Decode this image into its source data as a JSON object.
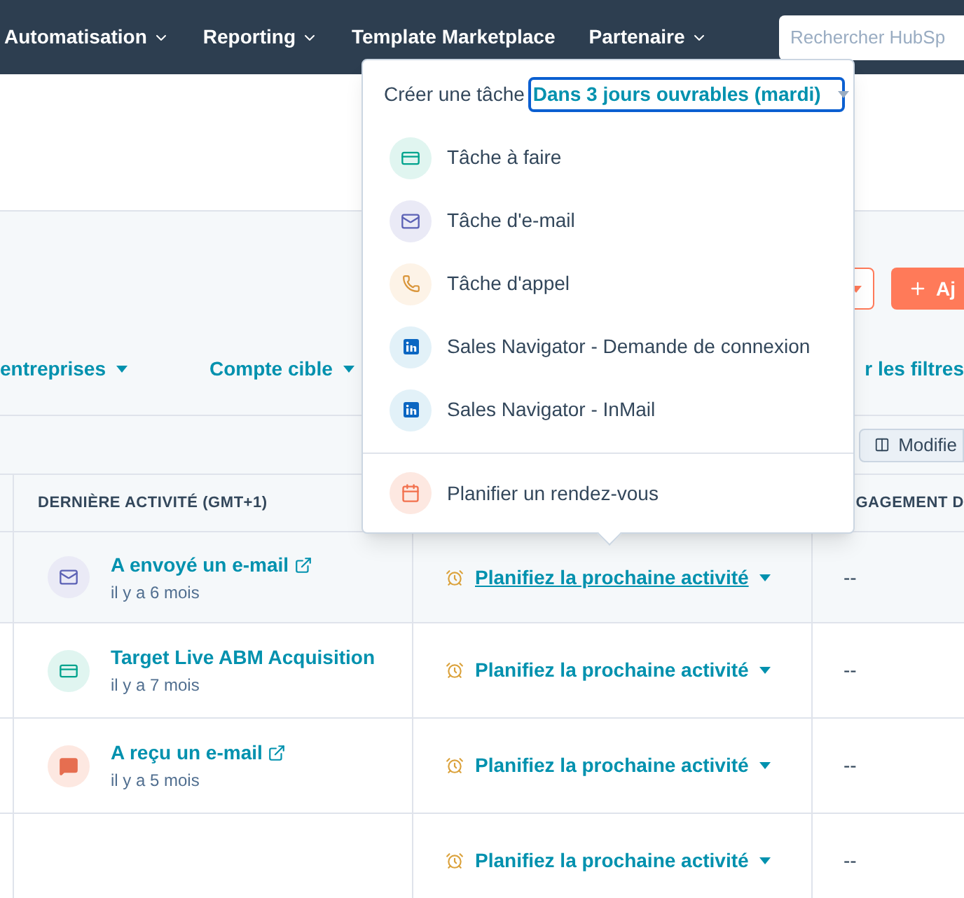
{
  "nav": {
    "items": [
      {
        "label": "Automatisation",
        "caret": true
      },
      {
        "label": "Reporting",
        "caret": true
      },
      {
        "label": "Template Marketplace",
        "caret": false
      },
      {
        "label": "Partenaire",
        "caret": true
      }
    ],
    "search": {
      "placeholder": "Rechercher HubSp"
    }
  },
  "toolbar": {
    "add_button": "Aj"
  },
  "filters": [
    {
      "label": "entreprises",
      "caret": true
    },
    {
      "label": "Compte cible",
      "caret": true
    },
    {
      "label": "r les filtres",
      "caret": false
    }
  ],
  "edit_button": "Modifie",
  "table": {
    "columns": [
      "DERNIÈRE ACTIVITÉ (GMT+1)",
      "GAGEMENT D"
    ],
    "rows": [
      {
        "activity": "A envoyé un e-mail",
        "time": "il y a 6 mois",
        "kind": "email",
        "external": true,
        "next": "Planifiez la prochaine activité",
        "selected": true,
        "engagement": "--"
      },
      {
        "activity": "Target Live ABM Acquisition",
        "time": "il y a 7 mois",
        "kind": "task",
        "external": false,
        "next": "Planifiez la prochaine activité",
        "selected": false,
        "engagement": "--"
      },
      {
        "activity": "A reçu un e-mail",
        "time": "il y a 5 mois",
        "kind": "chat",
        "external": true,
        "next": "Planifiez la prochaine activité",
        "selected": false,
        "engagement": "--"
      },
      {
        "next": "Planifiez la prochaine activité",
        "kind": "none",
        "selected": false,
        "engagement": "--"
      }
    ]
  },
  "popup": {
    "label": "Créer une tâche",
    "due": "Dans 3 jours ouvrables (mardi)",
    "items": [
      {
        "label": "Tâche à faire",
        "kind": "todo"
      },
      {
        "label": "Tâche d'e-mail",
        "kind": "email"
      },
      {
        "label": "Tâche d'appel",
        "kind": "call"
      },
      {
        "label": "Sales Navigator - Demande de connexion",
        "kind": "linkedin"
      },
      {
        "label": "Sales Navigator - InMail",
        "kind": "linkedin"
      }
    ],
    "footer": {
      "label": "Planifier un rendez-vous",
      "kind": "meeting"
    }
  }
}
